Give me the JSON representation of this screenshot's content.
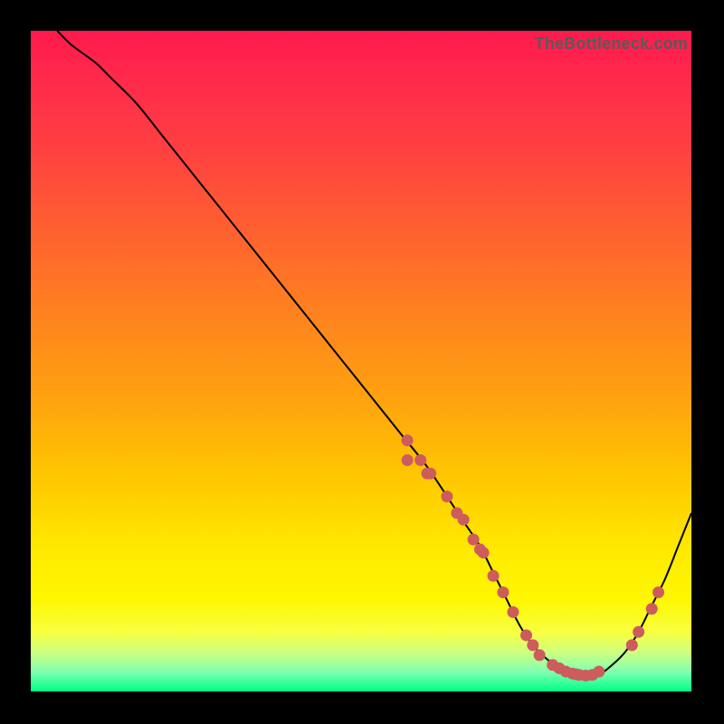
{
  "watermark": "TheBottleneck.com",
  "chart_data": {
    "type": "line",
    "title": "",
    "xlabel": "",
    "ylabel": "",
    "xlim": [
      0,
      100
    ],
    "ylim": [
      0,
      100
    ],
    "curve": {
      "name": "bottleneck-curve",
      "x": [
        4,
        6,
        8,
        10,
        12,
        16,
        20,
        24,
        28,
        32,
        36,
        40,
        44,
        48,
        52,
        56,
        60,
        64,
        66,
        68,
        70,
        72,
        74,
        76,
        78,
        80,
        82,
        84,
        86,
        88,
        90,
        92,
        94,
        96,
        98,
        100
      ],
      "y": [
        100,
        98,
        96.5,
        95,
        93,
        89,
        84,
        79,
        74,
        69,
        64,
        59,
        54,
        49,
        44,
        39,
        34,
        28,
        25,
        22,
        18,
        14,
        10,
        7,
        5,
        3.5,
        2.5,
        2,
        2.5,
        4,
        6,
        9,
        13,
        17,
        22,
        27
      ]
    },
    "points": {
      "name": "gpu-markers",
      "x": [
        57,
        57,
        59,
        60,
        60.5,
        63,
        64.5,
        65.5,
        67,
        68,
        68.5,
        70,
        71.5,
        73,
        75,
        76,
        77,
        79,
        80,
        81,
        82,
        82.5,
        83,
        84,
        85,
        86,
        91,
        92,
        94,
        95
      ],
      "y": [
        38,
        35,
        35,
        33,
        33,
        29.5,
        27,
        26,
        23,
        21.5,
        21,
        17.5,
        15,
        12,
        8.5,
        7,
        5.5,
        4,
        3.5,
        3,
        2.7,
        2.6,
        2.5,
        2.4,
        2.5,
        3,
        7,
        9,
        12.5,
        15
      ]
    }
  }
}
